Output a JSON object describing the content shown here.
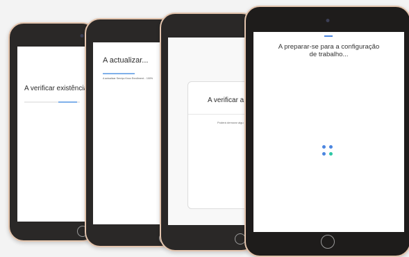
{
  "screens": {
    "checking": {
      "title": "A verificar existência de at"
    },
    "updating": {
      "title": "A actualizar...",
      "subtitle": "A actualizar Serviço Knox Enrollment... 100%"
    },
    "checking_card": {
      "title": "A verificar a",
      "subtitle": "Poderá demorar algu"
    },
    "preparing": {
      "title_line1": "A preparar-se para a configuração",
      "title_line2": "de trabalho..."
    }
  },
  "colors": {
    "progress": "#7fb0ea",
    "accent_blue": "#4c86e0",
    "accent_green": "#2ec7a5",
    "bezel_trim": "#e3c4ad"
  },
  "icons": [
    "camera-icon",
    "home-button-icon",
    "loading-dots-icon"
  ]
}
